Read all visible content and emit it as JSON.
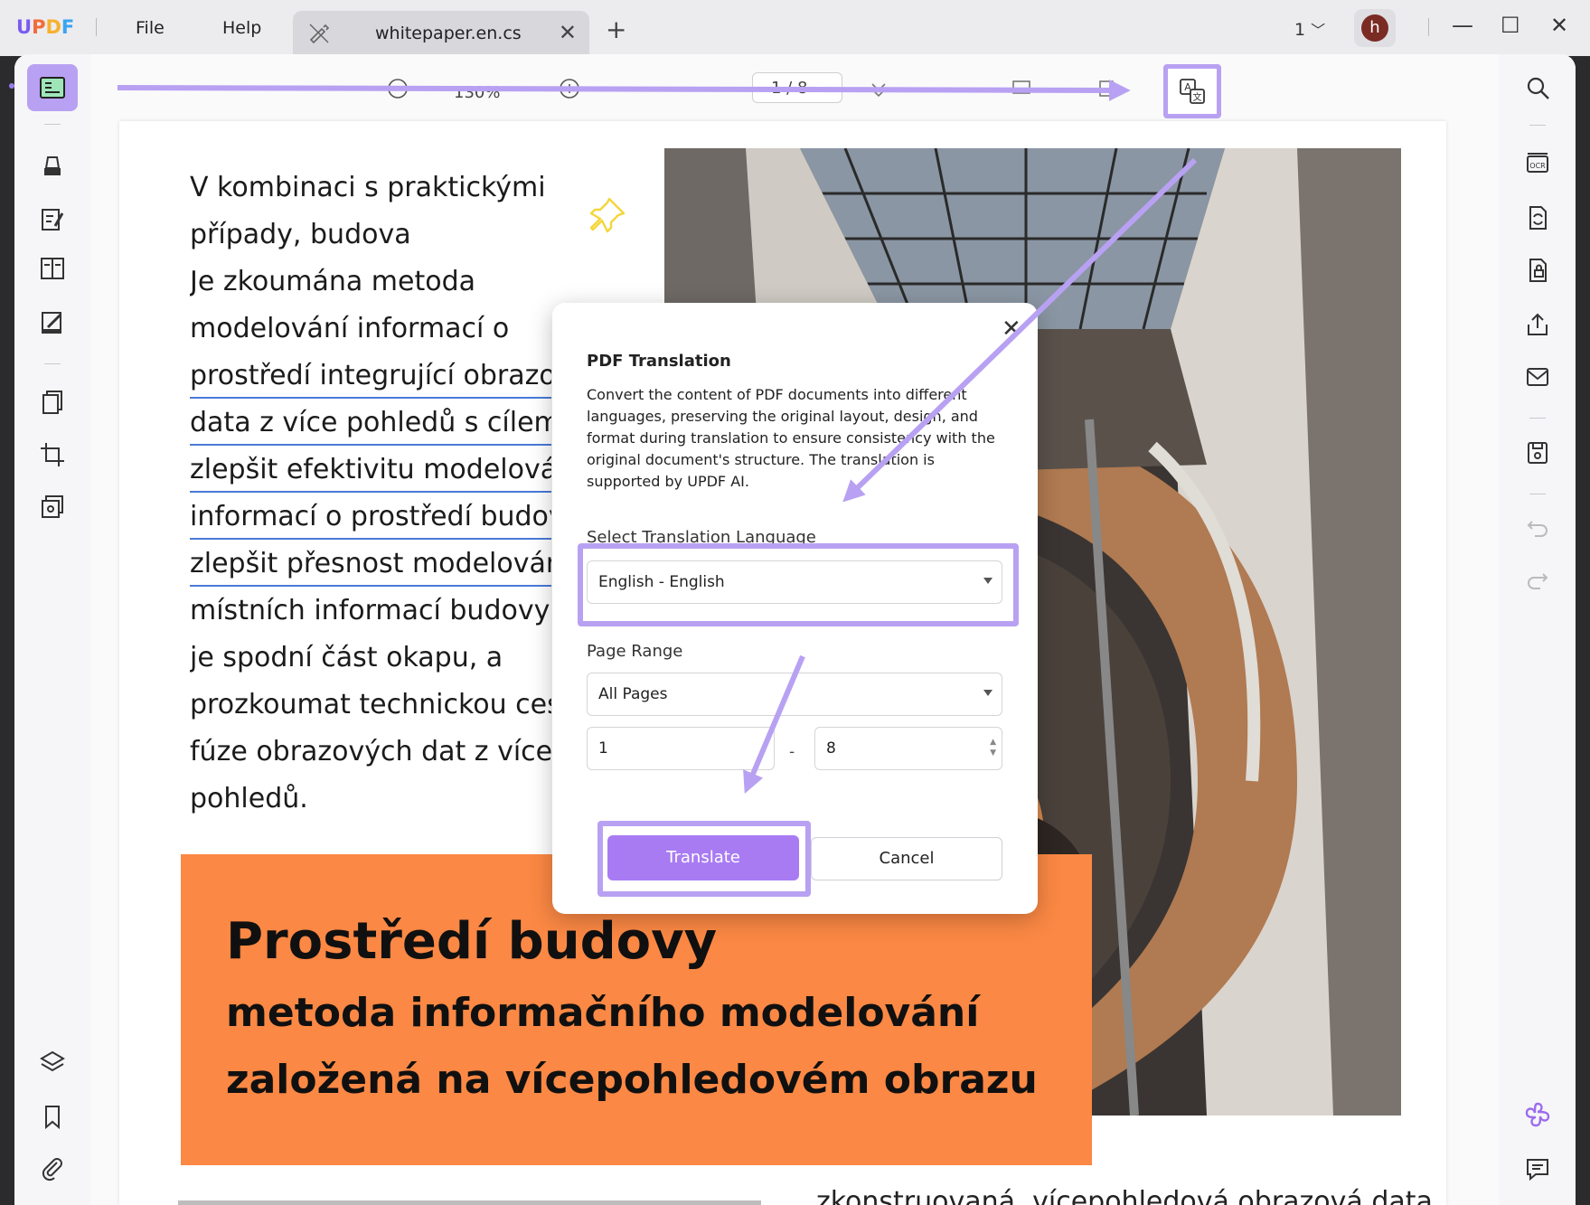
{
  "app": {
    "logo": {
      "u": "U",
      "p": "P",
      "d": "D",
      "f": "F"
    },
    "menu": {
      "file": "File",
      "help": "Help"
    },
    "tab": {
      "title": "whitepaper.en.cs",
      "close": "✕",
      "add": "+"
    },
    "page_indicator": "1",
    "avatar_letter": "h",
    "window": {
      "minimize": "—",
      "maximize": "☐",
      "close": "✕"
    }
  },
  "toolbar": {
    "zoom": "130%",
    "page_box": "1 / 8"
  },
  "document": {
    "paragraph_plain_top": [
      "V kombinaci s praktickými",
      "případy, budova",
      "Je zkoumána metoda",
      "modelování informací o"
    ],
    "paragraph_underlined": [
      "prostředí integrující obrazová",
      "data z více pohledů s cílem",
      "zlepšit efektivitu modelování",
      "informací o prostředí budovy",
      "zlepšit přesnost modelování"
    ],
    "paragraph_plain_bottom": [
      "místních informací budovy, jak",
      "je spodní část okapu, a",
      "prozkoumat technickou cestu",
      "fúze obrazových dat z více",
      "pohledů."
    ],
    "banner_title": "Prostředí budovy",
    "banner_line1": "metoda informačního modelování",
    "banner_line2": "založená na vícepohledovém obrazu",
    "bottom_text": "zkonstruovaná, vícepohledová obrazová data"
  },
  "dialog": {
    "title": "PDF Translation",
    "description": "Convert the content of PDF documents into different languages, preserving the original layout, design, and format during translation to ensure consistency with the original document's structure. The translation is supported by UPDF AI.",
    "language_label": "Select Translation Language",
    "language_value": "English - English",
    "range_label": "Page Range",
    "range_value": "All Pages",
    "from_page": "1",
    "range_dash": "-",
    "to_page": "8",
    "translate_button": "Translate",
    "cancel_button": "Cancel",
    "close": "✕"
  },
  "colors": {
    "accent": "#a87bf3",
    "highlight": "#b8a1f2",
    "banner": "#fb8844",
    "underline": "#4a7ad8"
  }
}
